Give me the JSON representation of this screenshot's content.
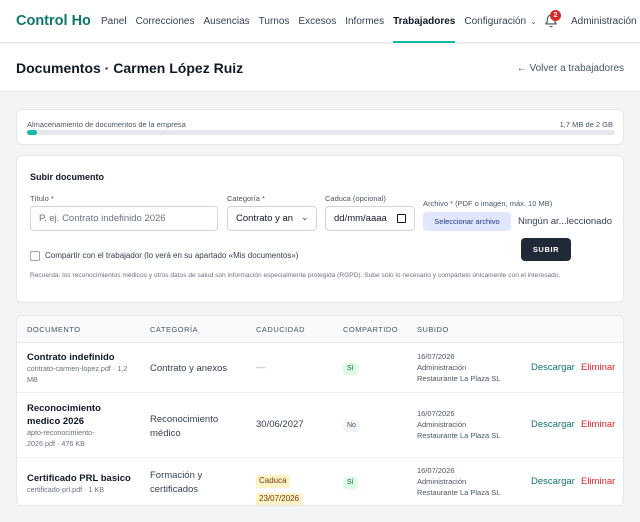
{
  "nav": {
    "brand": "Control Hor...",
    "items": [
      {
        "label": "Panel",
        "active": false
      },
      {
        "label": "Correcciones",
        "active": false
      },
      {
        "label": "Ausencias",
        "active": false
      },
      {
        "label": "Turnos",
        "active": false
      },
      {
        "label": "Excesos",
        "active": false
      },
      {
        "label": "Informes",
        "active": false
      },
      {
        "label": "Trabajadores",
        "active": true
      },
      {
        "label": "Configuración",
        "active": false
      }
    ],
    "notification_count": "2",
    "user": "Administración ..."
  },
  "header": {
    "title": "Documentos · Carmen López Ruiz",
    "back_link": "← Volver a trabajadores"
  },
  "storage": {
    "label": "Almacenamiento de documentos de la empresa",
    "value": "1,7 MB de 2 GB",
    "used_percent": 1.7
  },
  "upload": {
    "heading": "Subir documento",
    "title_label": "Título *",
    "title_placeholder": "P. ej. Contrato indefinido 2026",
    "category_label": "Categoría *",
    "category_value": "Contrato y an",
    "expiry_label": "Caduca (opcional)",
    "expiry_placeholder": "dd/mm/aaaa",
    "file_label": "Archivo * (PDF o imagen, máx. 10 MB)",
    "file_button": "Seleccionar archivo",
    "file_name": "Ningún ar...leccionado",
    "share_label": "Compartir con el trabajador (lo verá en su apartado «Mis documentos»)",
    "submit": "SUBIR",
    "notice": "Recuerda: los reconocimientos médicos y otros datos de salud son información especialmente protegida (RGPD). Sube solo lo necesario y compártelo únicamente con el interesado."
  },
  "table": {
    "headers": {
      "document": "DOCUMENTO",
      "category": "CATEGORÍA",
      "expiry": "CADUCIDAD",
      "shared": "COMPARTIDO",
      "uploaded": "SUBIDO"
    },
    "rows": [
      {
        "name": "Contrato indefinido",
        "meta": "contrato-carmen-lopez.pdf · 1,2 MB",
        "category": "Contrato y anexos",
        "expiry": "—",
        "shared": "Sí",
        "uploaded_date": "16/07/2026",
        "uploaded_by_1": "Administración",
        "uploaded_by_2": "Restaurante La Plaza SL",
        "download": "Descargar",
        "remove": "Eliminar"
      },
      {
        "name": "Reconocimiento medico 2026",
        "meta": "apto-reconocimiento-2026.pdf · 476 KB",
        "category": "Reconocimiento médico",
        "expiry": "30/06/2027",
        "shared": "No",
        "uploaded_date": "16/07/2026",
        "uploaded_by_1": "Administración",
        "uploaded_by_2": "Restaurante La Plaza SL",
        "download": "Descargar",
        "remove": "Eliminar"
      },
      {
        "name": "Certificado PRL basico",
        "meta": "certificado-prl.pdf · 1 KB",
        "category": "Formación y certificados",
        "expiry_line1": "Caduca",
        "expiry_line2": "23/07/2026",
        "shared": "Sí",
        "uploaded_date": "16/07/2026",
        "uploaded_by_1": "Administración",
        "uploaded_by_2": "Restaurante La Plaza SL",
        "download": "Descargar",
        "remove": "Eliminar"
      }
    ]
  },
  "colors": {
    "accent": "#14b8a6",
    "brand": "#0f766e",
    "danger": "#dc2626",
    "dark_button": "#1f2937"
  }
}
